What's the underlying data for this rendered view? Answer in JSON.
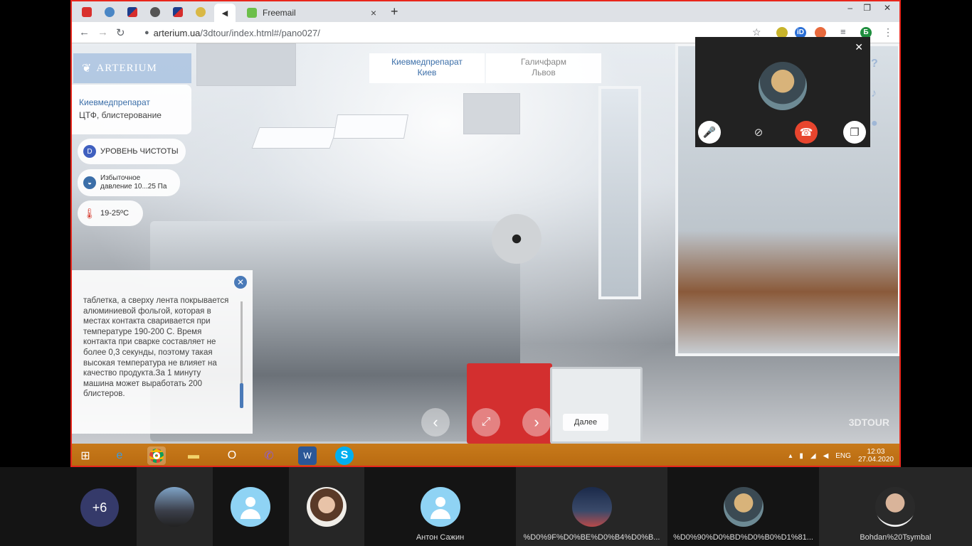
{
  "browser": {
    "tabs": [
      {
        "label": "Freemail",
        "close": "×"
      }
    ],
    "new_tab": "+",
    "address": {
      "host": "arterium.ua",
      "path": "/3dtour/index.html#/pano027/"
    },
    "window_controls": [
      "–",
      "❐",
      "✕"
    ],
    "profile_initial": "Б"
  },
  "pano": {
    "logo": "ARTERIUM",
    "location_title": "Киевмедпрепарат",
    "location_sub": "ЦТФ, блистерование",
    "badges": {
      "cleanliness_icon": "D",
      "cleanliness": "УРОВЕНЬ ЧИСТОТЫ",
      "pressure_line1": "Избыточное",
      "pressure_line2": "давление 10...25 Па",
      "temperature": "19-25ºC"
    },
    "cities": [
      {
        "name": "Киевмедпрепарат",
        "city": "Киев"
      },
      {
        "name": "Галичфарм",
        "city": "Львов"
      }
    ],
    "info_text": "таблетка, а сверху лента покрывается алюминиевой фольгой, которая в местах контакта сваривается при температуре 190-200 С. Время контакта при сварке составляет не более 0,3 секунды, поэтому такая высокая температура не влияет на качество продукта.За 1 минуту машина может выработать 200 блистеров.",
    "next_label": "Далее",
    "watermark": "3DTOUR",
    "help_icon": "?"
  },
  "taskbar": {
    "lang": "ENG",
    "time": "12:03",
    "date": "27.04.2020"
  },
  "participants": {
    "more": "+6",
    "names": [
      "Антон Сажин",
      "%D0%9F%D0%BE%D0%B4%D0%B...",
      "%D0%90%D0%BD%D0%B0%D1%81...",
      "Bohdan%20Tsymbal"
    ]
  }
}
